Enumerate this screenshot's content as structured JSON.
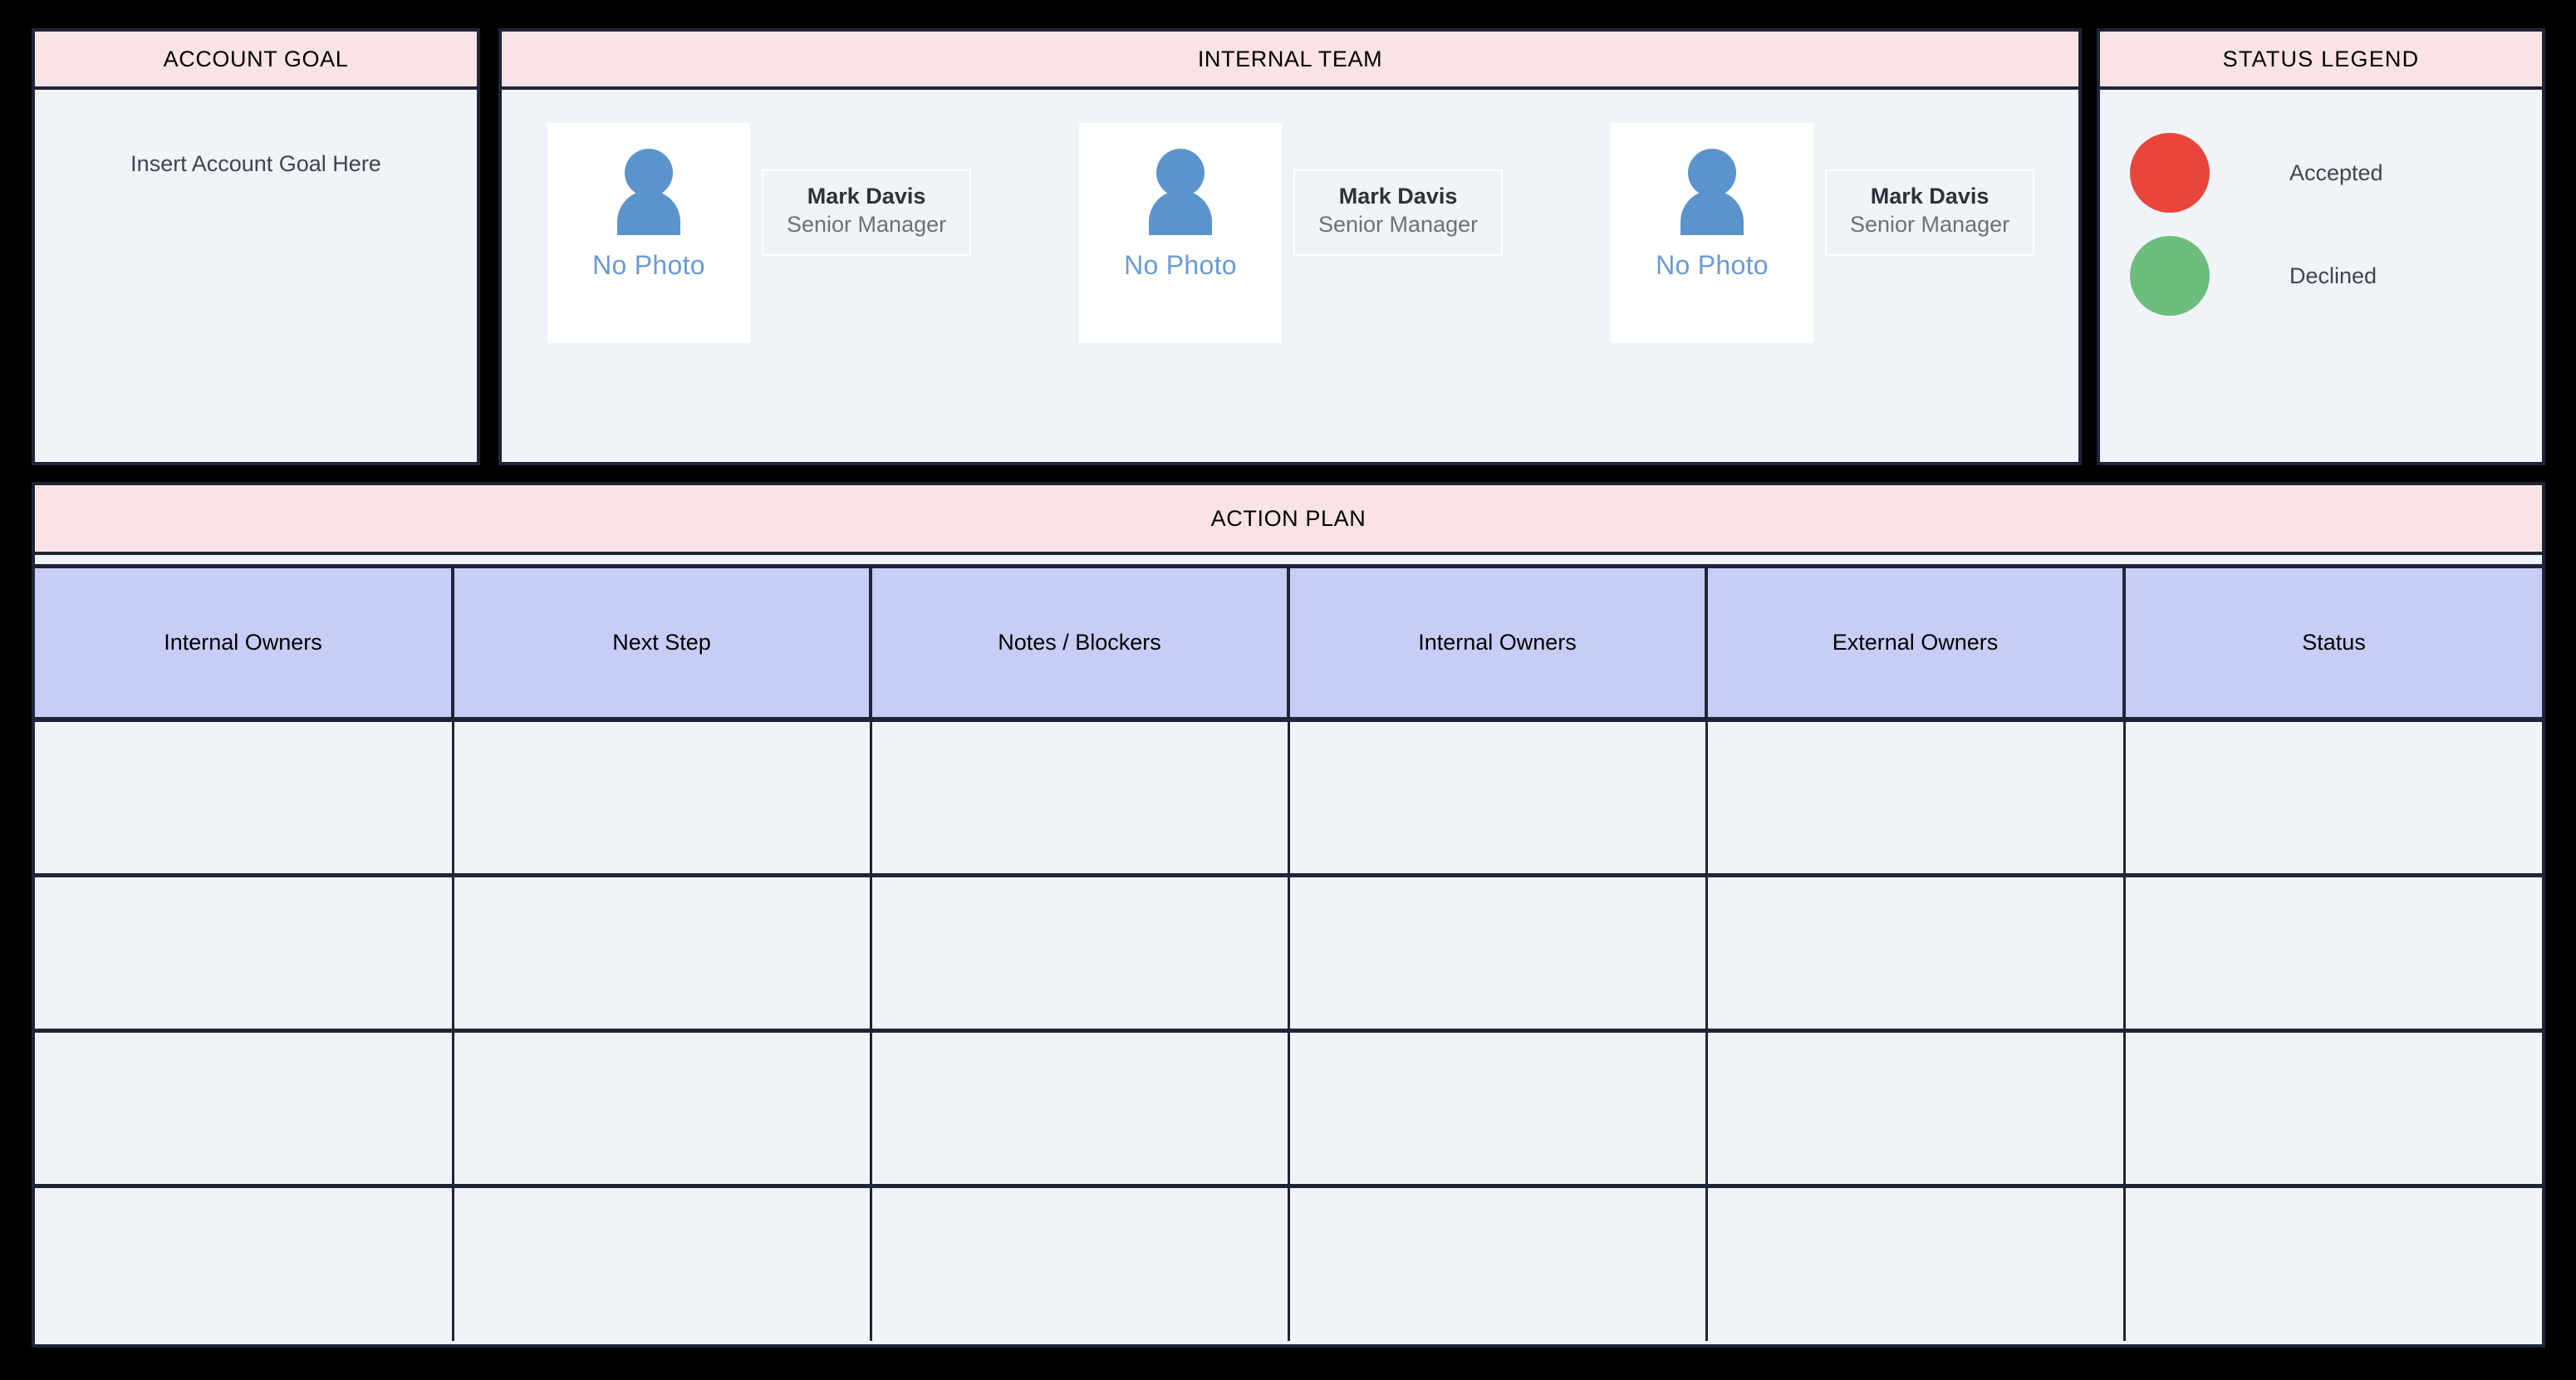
{
  "colors": {
    "board_background": "#000000",
    "panel_border": "#1f2538",
    "header_pink": "#fae3e4",
    "panel_body": "#f0f4f9",
    "table_header_lavender": "#c8cdf7",
    "accepted_red": "#e8463c",
    "declined_green": "#6cbd7e",
    "avatar_blue": "#5b94cc",
    "no_photo_blue": "#6a9bd1"
  },
  "account_goal": {
    "title": "ACCOUNT GOAL",
    "body_text": "Insert Account Goal Here"
  },
  "internal_team": {
    "title": "INTERNAL TEAM",
    "members": [
      {
        "name": "Mark Davis",
        "role": "Senior Manager",
        "photo_placeholder": "No Photo",
        "avatar_icon": "person-icon"
      },
      {
        "name": "Mark Davis",
        "role": "Senior Manager",
        "photo_placeholder": "No Photo",
        "avatar_icon": "person-icon"
      },
      {
        "name": "Mark Davis",
        "role": "Senior Manager",
        "photo_placeholder": "No Photo",
        "avatar_icon": "person-icon"
      }
    ]
  },
  "status_legend": {
    "title": "STATUS LEGEND",
    "items": [
      {
        "label": "Accepted",
        "color": "#e8463c",
        "icon": "circle-icon"
      },
      {
        "label": "Declined",
        "color": "#6cbd7e",
        "icon": "circle-icon"
      }
    ]
  },
  "action_plan": {
    "title": "ACTION PLAN",
    "columns": [
      "Internal Owners",
      "Next Step",
      "Notes / Blockers",
      "Internal Owners",
      "External Owners",
      "Status"
    ],
    "rows": [
      [
        "",
        "",
        "",
        "",
        "",
        ""
      ],
      [
        "",
        "",
        "",
        "",
        "",
        ""
      ],
      [
        "",
        "",
        "",
        "",
        "",
        ""
      ],
      [
        "",
        "",
        "",
        "",
        "",
        ""
      ]
    ]
  }
}
